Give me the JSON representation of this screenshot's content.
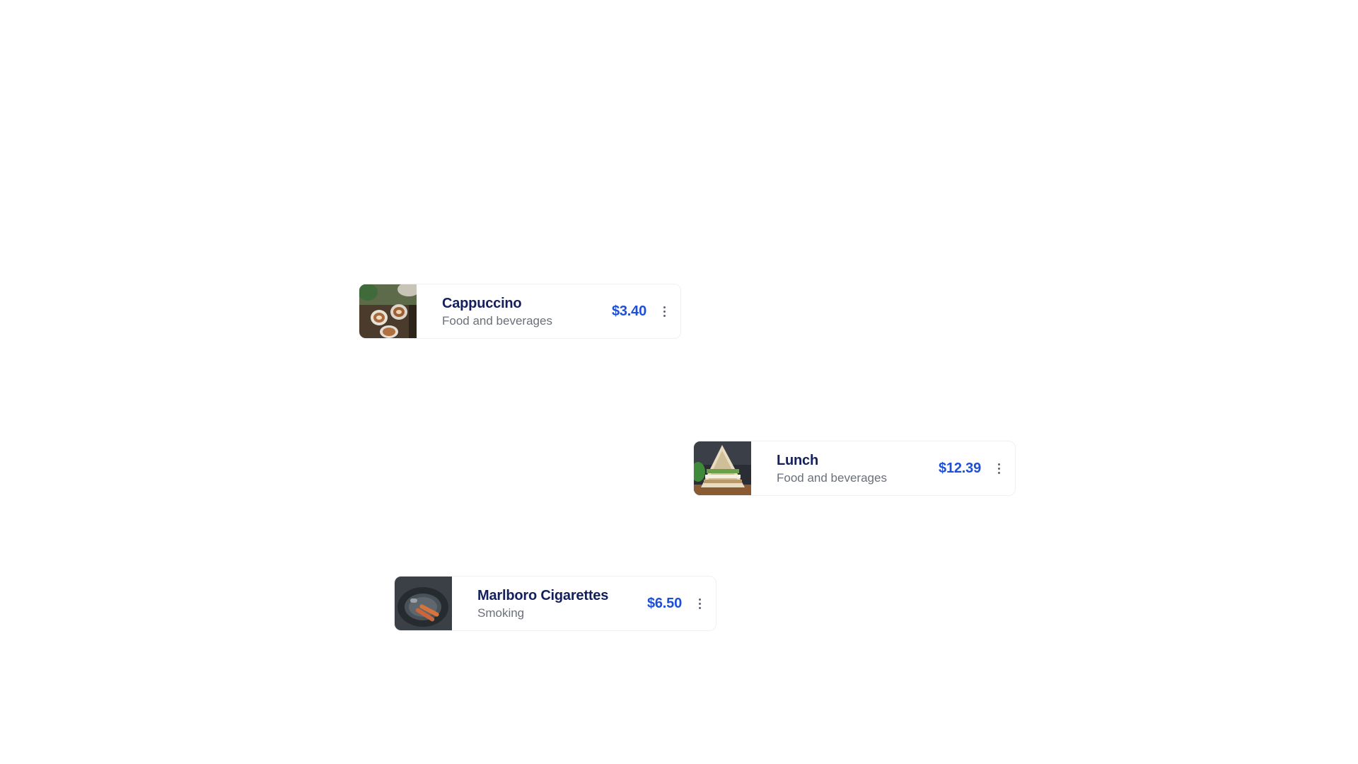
{
  "transactions": [
    {
      "title": "Cappuccino",
      "category": "Food and beverages",
      "price": "$3.40",
      "image_icon": "coffee-cups-photo",
      "more_icon": "more-vertical-icon"
    },
    {
      "title": "Lunch",
      "category": "Food and beverages",
      "price": "$12.39",
      "image_icon": "sandwich-photo",
      "more_icon": "more-vertical-icon"
    },
    {
      "title": "Marlboro Cigarettes",
      "category": "Smoking",
      "price": "$6.50",
      "image_icon": "ashtray-cigarettes-photo",
      "more_icon": "more-vertical-icon"
    }
  ],
  "colors": {
    "title": "#13205c",
    "category": "#6b6f78",
    "price": "#1d4fd8",
    "card_border": "#eef0f3"
  }
}
